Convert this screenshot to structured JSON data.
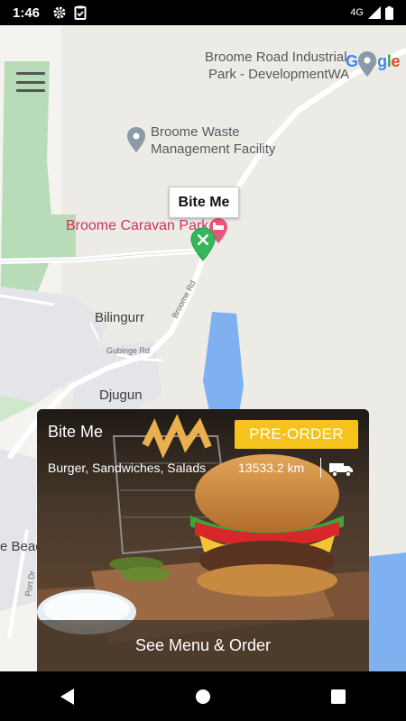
{
  "status_bar": {
    "time": "1:46",
    "icons": [
      "gear-icon",
      "clipboard-icon"
    ],
    "network": "4G",
    "signal_icon": "signal-icon",
    "battery_icon": "battery-icon"
  },
  "map": {
    "logo": [
      "G",
      "o",
      "o",
      "g",
      "l",
      "e"
    ],
    "logo_colors": [
      "#4285F4",
      "#EA4335",
      "#FBBC05",
      "#4285F4",
      "#34A853",
      "#EA4335"
    ],
    "places": {
      "industrial_park_line1": "Broome Road Industrial",
      "industrial_park_line2": "Park - DevelopmentWA",
      "waste_line1": "Broome Waste",
      "waste_line2": "Management Facility",
      "caravan_park": "Broome Caravan Park",
      "bilingurr": "Bilingurr",
      "djugun": "Djugun",
      "beach_partial": "e Beac",
      "gubinge_rd": "Gubinge Rd",
      "broome_rd": "Broome Rd",
      "port_dr": "Port Dr"
    },
    "marker_tooltip": "Bite Me",
    "water_color": "#7fb1f0",
    "park_color": "#b9dcb8"
  },
  "card": {
    "name": "Bite Me",
    "preorder_label": "PRE-ORDER",
    "cuisines": "Burger, Sandwiches, Salads",
    "distance": "13533.2 km",
    "cta": "See Menu & Order",
    "accent": "#f6c21c"
  },
  "nav": {
    "back_icon": "back-triangle-icon",
    "home_icon": "home-circle-icon",
    "recents_icon": "recents-square-icon"
  }
}
